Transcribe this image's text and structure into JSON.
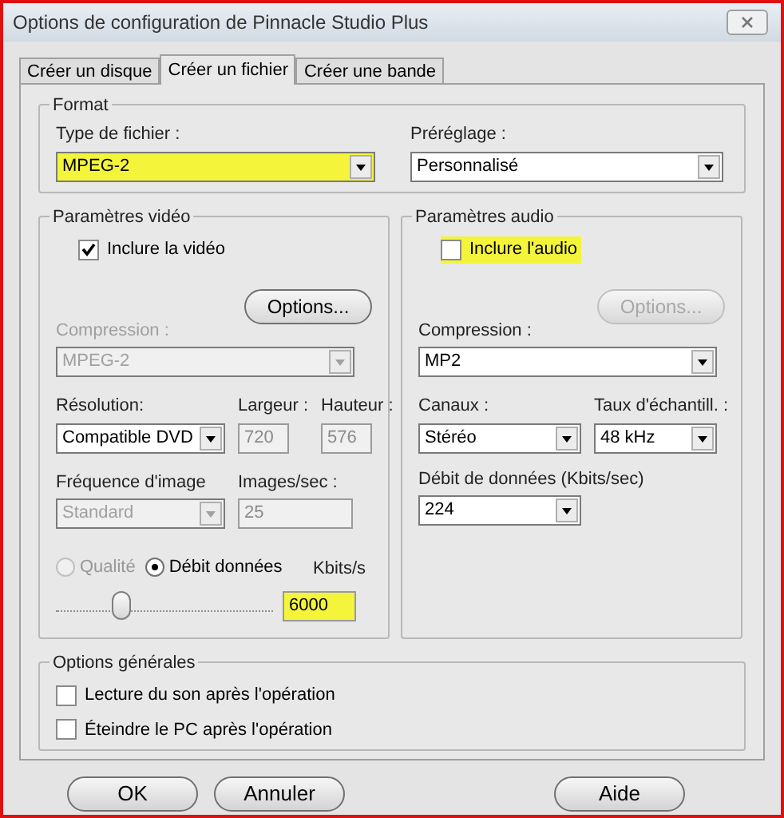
{
  "window": {
    "title": "Options de configuration de Pinnacle Studio Plus"
  },
  "tabs": [
    {
      "label": "Créer un disque",
      "selected": false
    },
    {
      "label": "Créer un fichier",
      "selected": true
    },
    {
      "label": "Créer une bande",
      "selected": false
    }
  ],
  "format": {
    "label": "Format",
    "fields": [
      {
        "label": "Type de fichier :",
        "value": "MPEG-2",
        "highlighted": true
      },
      {
        "label": "Préréglage :",
        "value": "Personnalisé",
        "highlighted": false
      }
    ]
  },
  "video": {
    "label": "Paramètres vidéo",
    "include": {
      "label": "Inclure la vidéo",
      "checked": true,
      "highlighted": false
    },
    "options_button": {
      "label": "Options...",
      "disabled": false
    },
    "compression": {
      "label": "Compression :",
      "value": "MPEG-2",
      "disabled": true
    },
    "resolution": {
      "label": "Résolution:",
      "value": "Compatible DVD",
      "disabled": false
    },
    "width": {
      "label": "Largeur :",
      "value": "720"
    },
    "height": {
      "label": "Hauteur :",
      "value": "576"
    },
    "frame_rate": {
      "label": "Fréquence d'image",
      "value": "Standard",
      "disabled": true
    },
    "fps": {
      "label": "Images/sec :",
      "value": "25"
    },
    "modes": [
      {
        "label": "Qualité",
        "selected": false,
        "disabled": true
      },
      {
        "label": "Débit données",
        "selected": true,
        "disabled": false
      }
    ],
    "bitrate": {
      "label": "Kbits/s",
      "value": "6000",
      "highlighted": true
    },
    "slider": {
      "level": 0.3
    }
  },
  "audio": {
    "label": "Paramètres audio",
    "include": {
      "label": "Inclure l'audio",
      "checked": false,
      "highlighted": true
    },
    "options_button": {
      "label": "Options...",
      "disabled": true
    },
    "compression": {
      "label": "Compression :",
      "value": "MP2",
      "disabled": false
    },
    "channels": {
      "label": "Canaux :",
      "value": "Stéréo",
      "disabled": false
    },
    "sample_rate": {
      "label": "Taux d'échantill. :",
      "value": "48 kHz",
      "disabled": false
    },
    "bitrate": {
      "label": "Débit de données (Kbits/sec)",
      "value": "224",
      "disabled": false
    }
  },
  "general": {
    "label": "Options générales",
    "options": [
      {
        "label": "Lecture du son après l'opération",
        "checked": false
      },
      {
        "label": "Éteindre le PC après l'opération",
        "checked": false
      }
    ]
  },
  "buttons": [
    {
      "label": "OK"
    },
    {
      "label": "Annuler"
    },
    {
      "label": "Aide"
    }
  ]
}
